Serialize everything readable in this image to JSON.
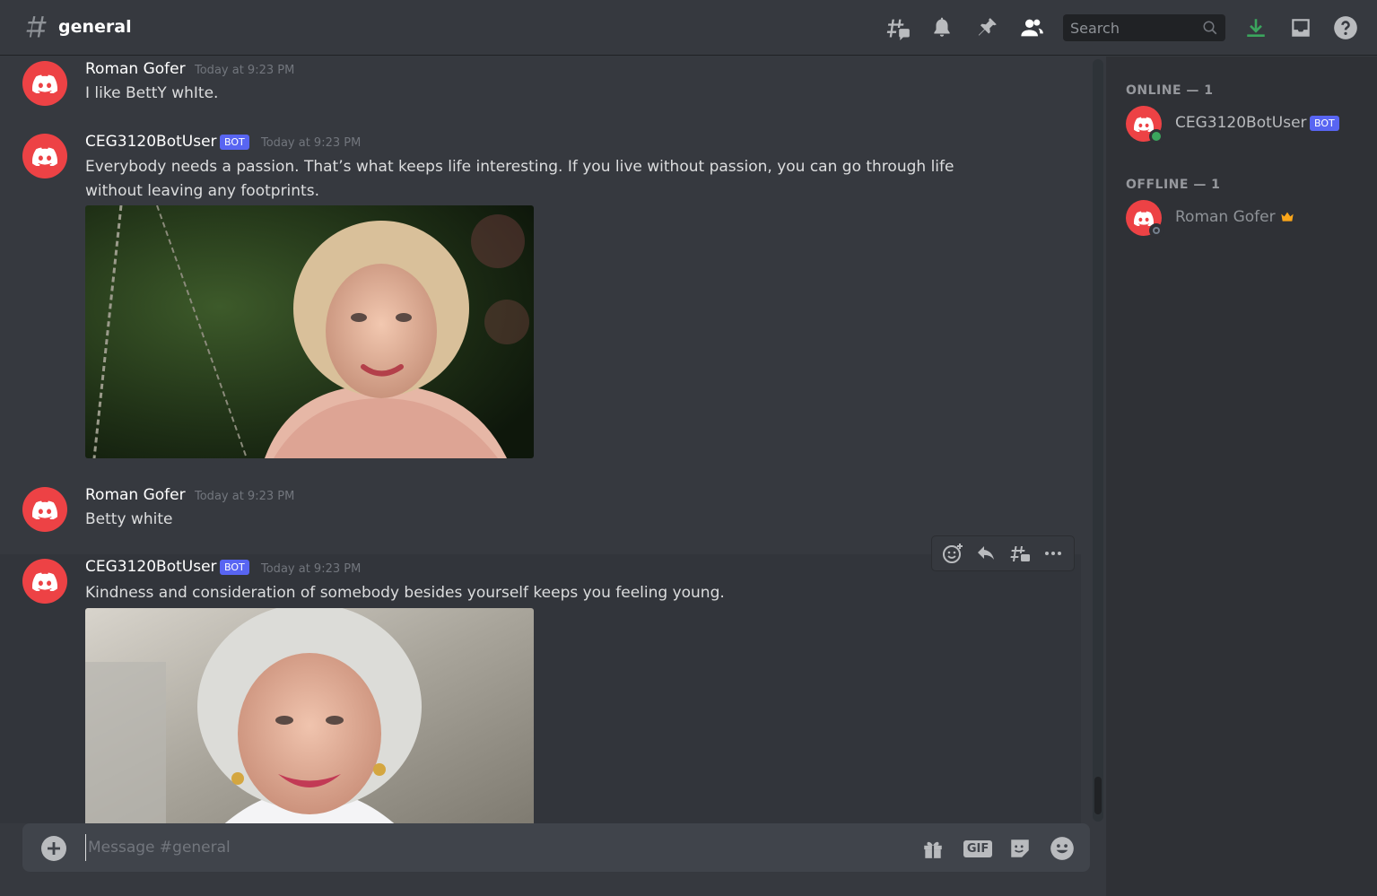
{
  "header": {
    "channel_name": "general",
    "search_placeholder": "Search"
  },
  "messages": [
    {
      "author": "Roman Gofer",
      "timestamp": "Today at 9:23 PM",
      "bot": false,
      "text": "I like BettY whIte."
    },
    {
      "author": "CEG3120BotUser",
      "timestamp": "Today at 9:23 PM",
      "bot": true,
      "bot_label": "BOT",
      "text": "Everybody needs a passion. That’s what keeps life interesting. If you live without passion, you can go through life without leaving any footprints.",
      "image": "photo"
    },
    {
      "author": "Roman Gofer",
      "timestamp": "Today at 9:23 PM",
      "bot": false,
      "text": "Betty white"
    },
    {
      "author": "CEG3120BotUser",
      "timestamp": "Today at 9:23 PM",
      "bot": true,
      "bot_label": "BOT",
      "text": "Kindness and consideration of somebody besides yourself keeps you feeling young.",
      "image": "photo"
    }
  ],
  "composer": {
    "placeholder": "Message #general",
    "gif_label": "GIF"
  },
  "members": {
    "online_heading": "ONLINE — 1",
    "offline_heading": "OFFLINE — 1",
    "online": [
      {
        "name": "CEG3120BotUser",
        "bot_label": "BOT"
      }
    ],
    "offline": [
      {
        "name": "Roman Gofer",
        "owner": true
      }
    ]
  },
  "colors": {
    "background": "#36393f",
    "sidebar": "#2f3136",
    "blurple": "#5865f2",
    "avatar_red": "#ed4245",
    "online_green": "#3ba55d",
    "download_green": "#3ba55d",
    "crown_gold": "#faa61a"
  }
}
